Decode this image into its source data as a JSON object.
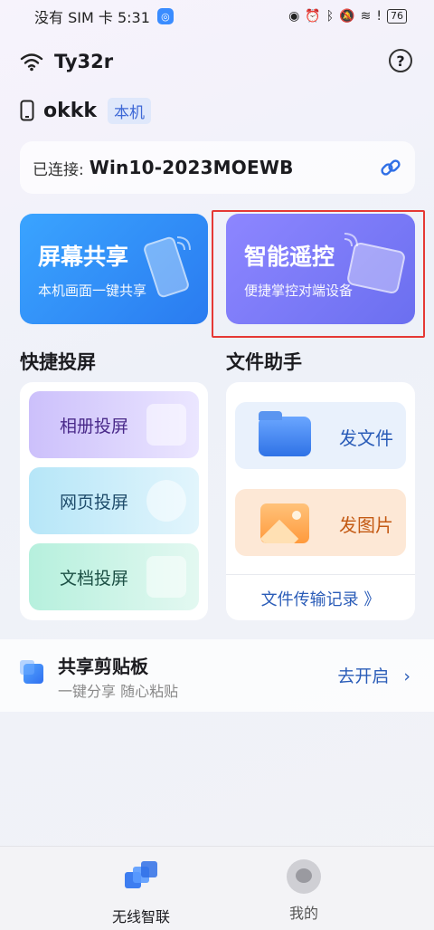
{
  "status_bar": {
    "carrier_time": "没有 SIM 卡 5:31",
    "battery": "76"
  },
  "wifi": {
    "name": "Ty32r"
  },
  "device": {
    "name": "okkk",
    "badge": "本机"
  },
  "connection": {
    "label": "已连接:",
    "value": "Win10-2023MOEWB"
  },
  "screen_share": {
    "title": "屏幕共享",
    "subtitle": "本机画面一键共享"
  },
  "remote_control": {
    "title": "智能遥控",
    "subtitle": "便捷掌控对端设备"
  },
  "quick_cast": {
    "title": "快捷投屏",
    "items": [
      "相册投屏",
      "网页投屏",
      "文档投屏"
    ]
  },
  "file_helper": {
    "title": "文件助手",
    "send_file": "发文件",
    "send_image": "发图片",
    "transfer_log": "文件传输记录 》"
  },
  "clipboard": {
    "title": "共享剪贴板",
    "subtitle": "一键分享 随心粘贴",
    "action": "去开启"
  },
  "nav": {
    "home": "无线智联",
    "mine": "我的"
  },
  "colors": {
    "accent": "#2a5cb8",
    "highlight": "#e53935"
  }
}
